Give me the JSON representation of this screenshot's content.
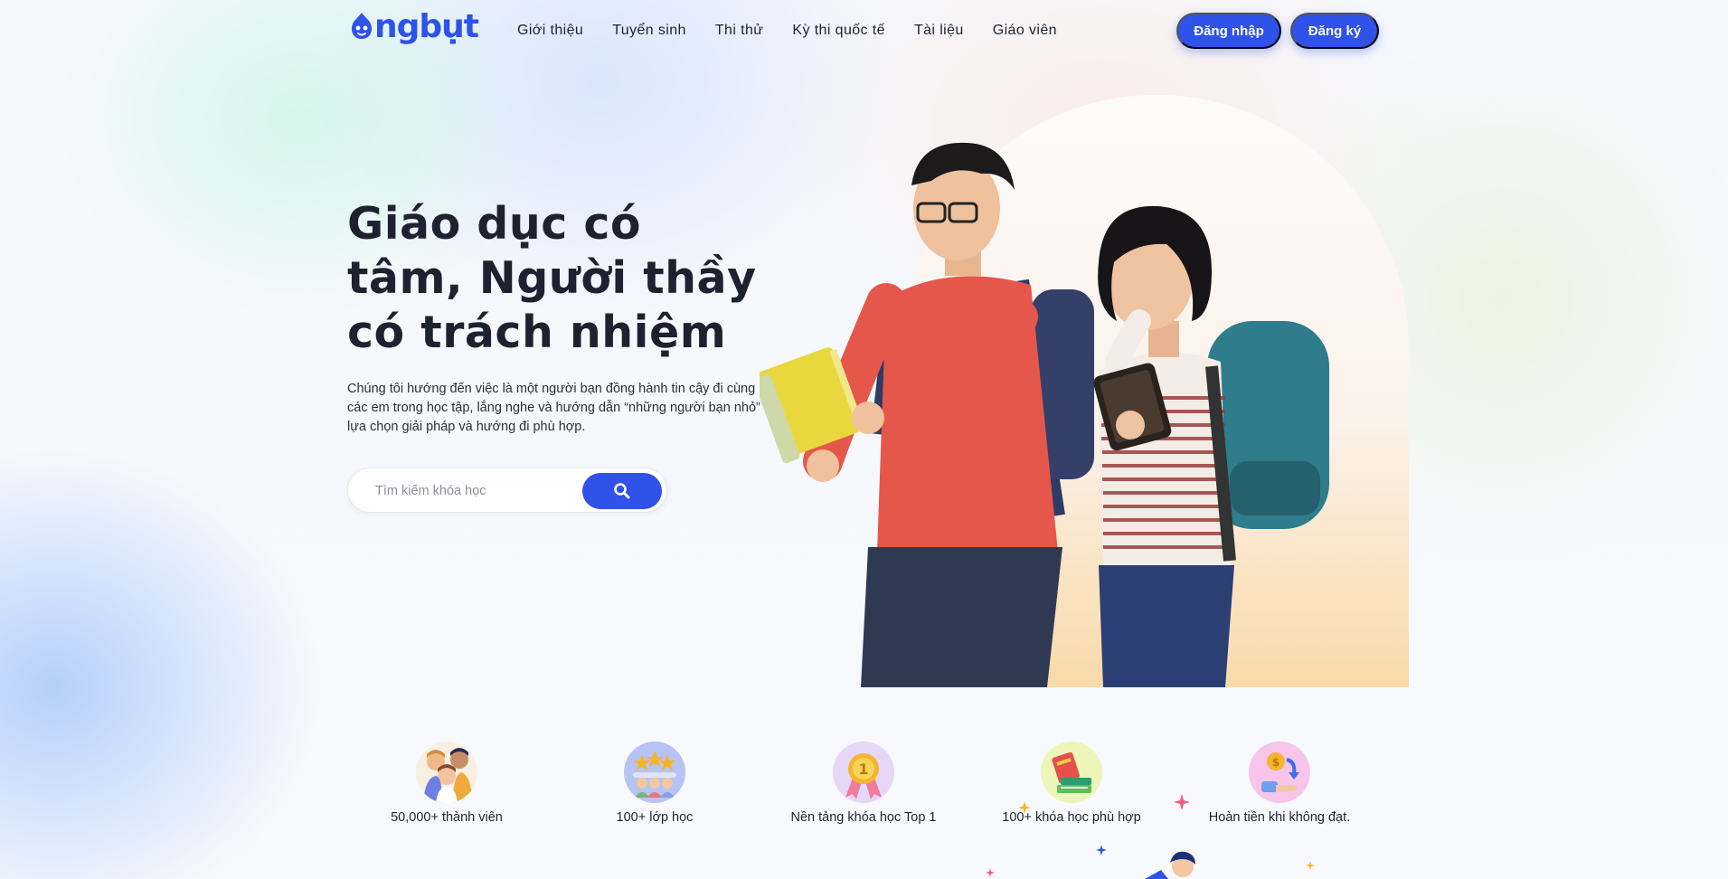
{
  "brand": {
    "name": "ngbụt",
    "color": "#2f52e8"
  },
  "nav": {
    "items": [
      {
        "label": "Giới thiệu"
      },
      {
        "label": "Tuyển sinh"
      },
      {
        "label": "Thi thử"
      },
      {
        "label": "Kỳ thi quốc tế"
      },
      {
        "label": "Tài liệu"
      },
      {
        "label": "Giáo viên"
      }
    ]
  },
  "auth": {
    "login_label": "Đăng nhập",
    "register_label": "Đăng ký"
  },
  "hero": {
    "title": "Giáo dục có tâm, Người thầy có trách nhiệm",
    "description": "Chúng tôi hướng đến việc là một người bạn đồng hành tin cậy đi cùng các em trong học tập, lắng nghe và hướng dẫn “những người bạn nhỏ” lựa chọn giải pháp và hướng đi phù hợp.",
    "search_placeholder": "Tìm kiếm khóa học",
    "search_value": "",
    "search_icon": "search-icon"
  },
  "stats": [
    {
      "label": "50,000+ thành viên",
      "icon": "members-icon"
    },
    {
      "label": "100+ lớp học",
      "icon": "classes-icon"
    },
    {
      "label": "Nền tảng khóa học Top 1",
      "icon": "medal-icon"
    },
    {
      "label": "100+ khóa học phù hợp",
      "icon": "books-icon"
    },
    {
      "label": "Hoàn tiền khi không đạt.",
      "icon": "refund-icon"
    }
  ],
  "colors": {
    "accent": "#2f52e8",
    "text": "#1f2330"
  }
}
